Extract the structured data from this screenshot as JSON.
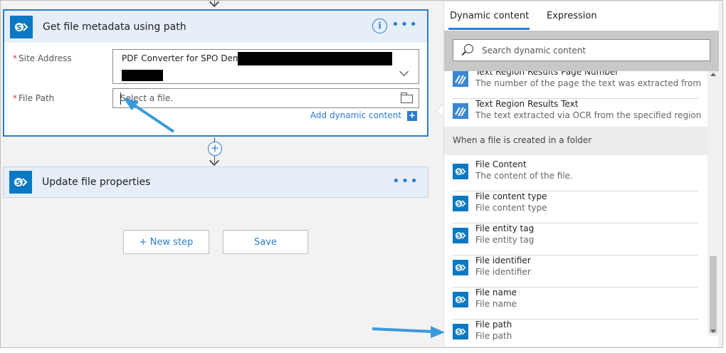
{
  "flow": {
    "card1": {
      "title": "Get file metadata using path",
      "info_label": "i",
      "more_label": "•••",
      "site_address_label": "Site Address",
      "site_address_value": "PDF Converter for SPO Demo -",
      "file_path_label": "File Path",
      "file_path_placeholder": "Select a file.",
      "add_dynamic_content": "Add dynamic content",
      "add_dynamic_icon": "+",
      "required_marker": "*"
    },
    "card2": {
      "title": "Update file properties",
      "more_label": "•••"
    },
    "add_step_icon": "+",
    "buttons": {
      "new_step": "+ New step",
      "save": "Save"
    }
  },
  "panel": {
    "tabs": [
      "Dynamic content",
      "Expression"
    ],
    "active_tab": 0,
    "search_placeholder": "Search dynamic content",
    "items_top": [
      {
        "title": "Text Region Results Page Number",
        "desc": "The number of the page the text was extracted from",
        "icon": "ocr-icon"
      },
      {
        "title": "Text Region Results Text",
        "desc": "The text extracted via OCR from the specified region",
        "icon": "ocr-icon"
      }
    ],
    "group_header": "When a file is created in a folder",
    "items": [
      {
        "title": "File Content",
        "desc": "The content of the file.",
        "icon": "sharepoint-icon"
      },
      {
        "title": "File content type",
        "desc": "File content type",
        "icon": "sharepoint-icon"
      },
      {
        "title": "File entity tag",
        "desc": "File entity tag",
        "icon": "sharepoint-icon"
      },
      {
        "title": "File identifier",
        "desc": "File identifier",
        "icon": "sharepoint-icon"
      },
      {
        "title": "File name",
        "desc": "File name",
        "icon": "sharepoint-icon"
      },
      {
        "title": "File path",
        "desc": "File path",
        "icon": "sharepoint-icon"
      }
    ]
  },
  "colors": {
    "accent": "#2b7cd3",
    "sharepoint": "#0a78c2",
    "annotation_arrow": "#3a9ad9"
  }
}
